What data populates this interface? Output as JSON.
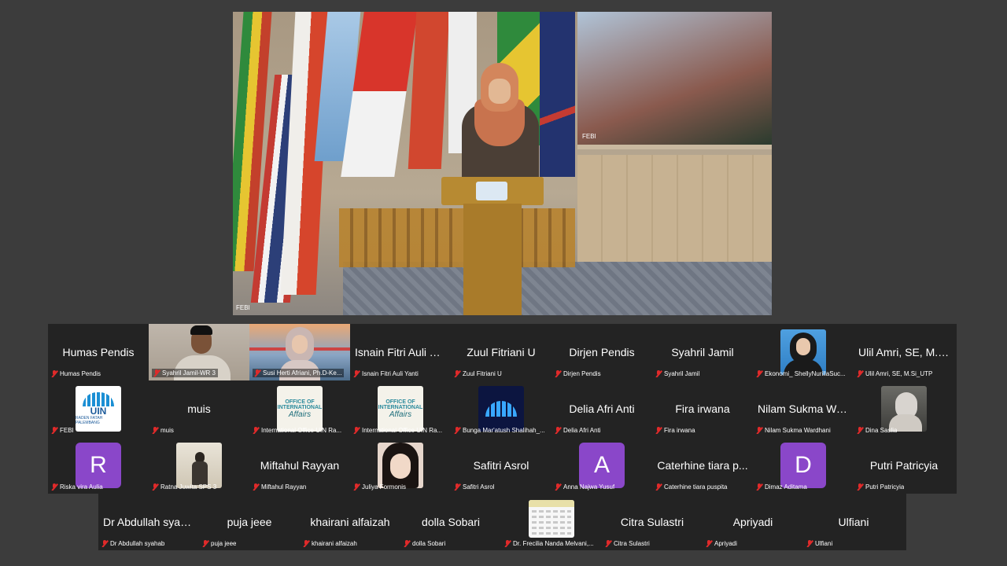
{
  "main_video": {
    "label": "FEBI",
    "window_label": "FEBI"
  },
  "rows": [
    [
      {
        "name": "Humas Pendis",
        "label": "Humas Pendis",
        "type": "name"
      },
      {
        "name": "",
        "label": "Syahril Jamil-WR 3",
        "type": "video",
        "kind": "man"
      },
      {
        "name": "",
        "label": "Susi Herti Afriani, Ph.D-Ke...",
        "type": "video",
        "kind": "woman-bridge"
      },
      {
        "name": "Isnain Fitri Auli Ya...",
        "label": "Isnain Fitri Auli Yanti",
        "type": "name"
      },
      {
        "name": "Zuul Fitriani U",
        "label": "Zuul Fitriani U",
        "type": "name"
      },
      {
        "name": "Dirjen Pendis",
        "label": "Dirjen Pendis",
        "type": "name"
      },
      {
        "name": "Syahril Jamil",
        "label": "Syahril Jamil",
        "type": "name"
      },
      {
        "name": "",
        "label": "Ekonomi_ ShellyNurillaSuc...",
        "type": "pic",
        "kind": "hijab-blue"
      },
      {
        "name": "Ulil Amri, SE, M.S...",
        "label": "Ulil Amri, SE, M.Si_UTP",
        "type": "name"
      }
    ],
    [
      {
        "name": "",
        "label": "FEBI",
        "type": "pic",
        "kind": "uin",
        "logo_text": "UIN",
        "logo_sub": "RADEN FATAH PALEMBANG"
      },
      {
        "name": "muis",
        "label": "muis",
        "type": "name"
      },
      {
        "name": "",
        "label": "International Office UIN Ra...",
        "type": "pic",
        "kind": "oia",
        "logo_l1": "OFFICE OF",
        "logo_l2": "INTERNATIONAL",
        "logo_l3": "Affairs"
      },
      {
        "name": "",
        "label": "International Office UIN Ra...",
        "type": "pic",
        "kind": "oia",
        "logo_l1": "OFFICE OF",
        "logo_l2": "INTERNATIONAL",
        "logo_l3": "Affairs"
      },
      {
        "name": "",
        "label": "Bunga Mar'atush Shalihah_...",
        "type": "pic",
        "kind": "dark-logo"
      },
      {
        "name": "Delia Afri Anti",
        "label": "Delia Afri Anti",
        "type": "name"
      },
      {
        "name": "Fira irwana",
        "label": "Fira irwana",
        "type": "name"
      },
      {
        "name": "Nilam Sukma Wa...",
        "label": "Nilam Sukma Wardhani",
        "type": "name"
      },
      {
        "name": "",
        "label": "Dina Saslia",
        "type": "pic",
        "kind": "hijab-room"
      }
    ],
    [
      {
        "name": "",
        "label": "Riska vira Aulia",
        "type": "avatar",
        "letter": "R"
      },
      {
        "name": "",
        "label": "Ratna Juwita SPS 3",
        "type": "pic",
        "kind": "person-room"
      },
      {
        "name": "Miftahul Rayyan",
        "label": "Miftahul Rayyan",
        "type": "name"
      },
      {
        "name": "",
        "label": "Juliya Formonis",
        "type": "pic",
        "kind": "girl"
      },
      {
        "name": "Safitri Asrol",
        "label": "Safitri Asrol",
        "type": "name"
      },
      {
        "name": "",
        "label": "Anna Najwa Yusuf",
        "type": "avatar",
        "letter": "A"
      },
      {
        "name": "Caterhine tiara p...",
        "label": "Caterhine tiara puspita",
        "type": "name"
      },
      {
        "name": "",
        "label": "Dimaz Aditama",
        "type": "avatar",
        "letter": "D"
      },
      {
        "name": "Putri Patricyia",
        "label": "Putri Patricyia",
        "type": "name"
      }
    ],
    [
      {
        "name": "Dr Abdullah syah...",
        "label": "Dr Abdullah syahab",
        "type": "name"
      },
      {
        "name": "puja jeee",
        "label": "puja jeee",
        "type": "name"
      },
      {
        "name": "khairani alfaizah",
        "label": "khairani alfaizah",
        "type": "name"
      },
      {
        "name": "dolla Sobari",
        "label": "dolla Sobari",
        "type": "name"
      },
      {
        "name": "",
        "label": "Dr. Frecilia Nanda Melvani,...",
        "type": "pic",
        "kind": "sheet"
      },
      {
        "name": "Citra Sulastri",
        "label": "Citra Sulastri",
        "type": "name"
      },
      {
        "name": "Apriyadi",
        "label": "Apriyadi",
        "type": "name"
      },
      {
        "name": "Ulfiani",
        "label": "Ulfiani",
        "type": "name"
      }
    ]
  ],
  "colors": {
    "background": "#3c3c3c",
    "tile_background": "#232323",
    "avatar_purple": "#8a47c9",
    "muted_mic": "#e02a2a"
  },
  "icons": {
    "muted": "mic-off-icon"
  }
}
